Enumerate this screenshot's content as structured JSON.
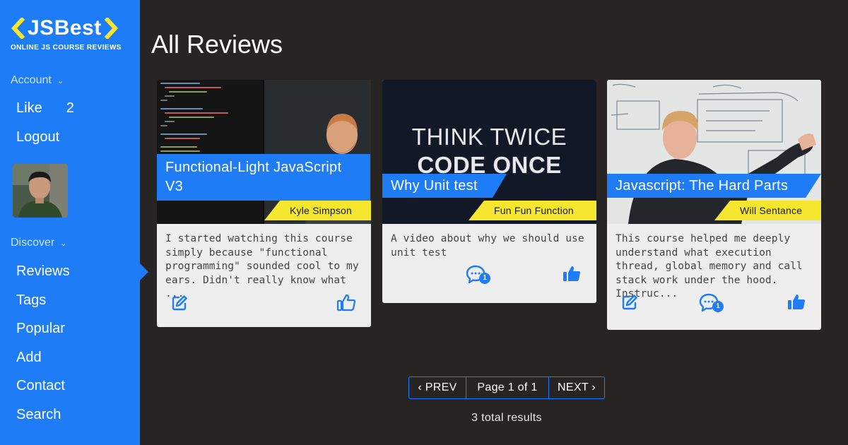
{
  "brand": {
    "name": "JSBest",
    "tagline": "ONLINE JS COURSE REVIEWS",
    "accent": "#1f7cf7",
    "highlight": "#f5e62e"
  },
  "sidebar": {
    "account_label": "Account",
    "account_chevron": "chevron-down-icon",
    "like_label": "Like",
    "like_count": "2",
    "logout_label": "Logout",
    "discover_label": "Discover",
    "discover_chevron": "chevron-down-icon",
    "nav": [
      "Reviews",
      "Tags",
      "Popular",
      "Add",
      "Contact",
      "Search"
    ],
    "active_item": "Reviews"
  },
  "main": {
    "title": "All Reviews",
    "cards": [
      {
        "title_line1": "Functional-Light JavaScript",
        "title_line2": "V3",
        "author": "Kyle Simpson",
        "description": "I started watching this course simply because \"functional programming\" sounded cool to my ears. Didn't really know what ...",
        "actions": [
          "edit-icon",
          "thumbs-up-icon"
        ]
      },
      {
        "title_line1": "Why Unit test",
        "thumb_text_line1": "THINK TWICE",
        "thumb_text_line2": "CODE ONCE",
        "author": "Fun Fun Function",
        "description": "A video about why we should use unit test",
        "comment_count": "1",
        "actions": [
          "comment-icon",
          "thumbs-up-icon"
        ]
      },
      {
        "title_line1": "Javascript: The Hard Parts",
        "author": "Will Sentance",
        "description": "This course helped me deeply understand what execution thread, global memory and call stack work under the hood. Instruc...",
        "comment_count": "1",
        "actions": [
          "edit-icon",
          "comment-icon",
          "thumbs-up-icon"
        ]
      }
    ]
  },
  "pagination": {
    "prev_label": "PREV",
    "page_label": "Page 1 of 1",
    "next_label": "NEXT",
    "total": "3 total results"
  }
}
